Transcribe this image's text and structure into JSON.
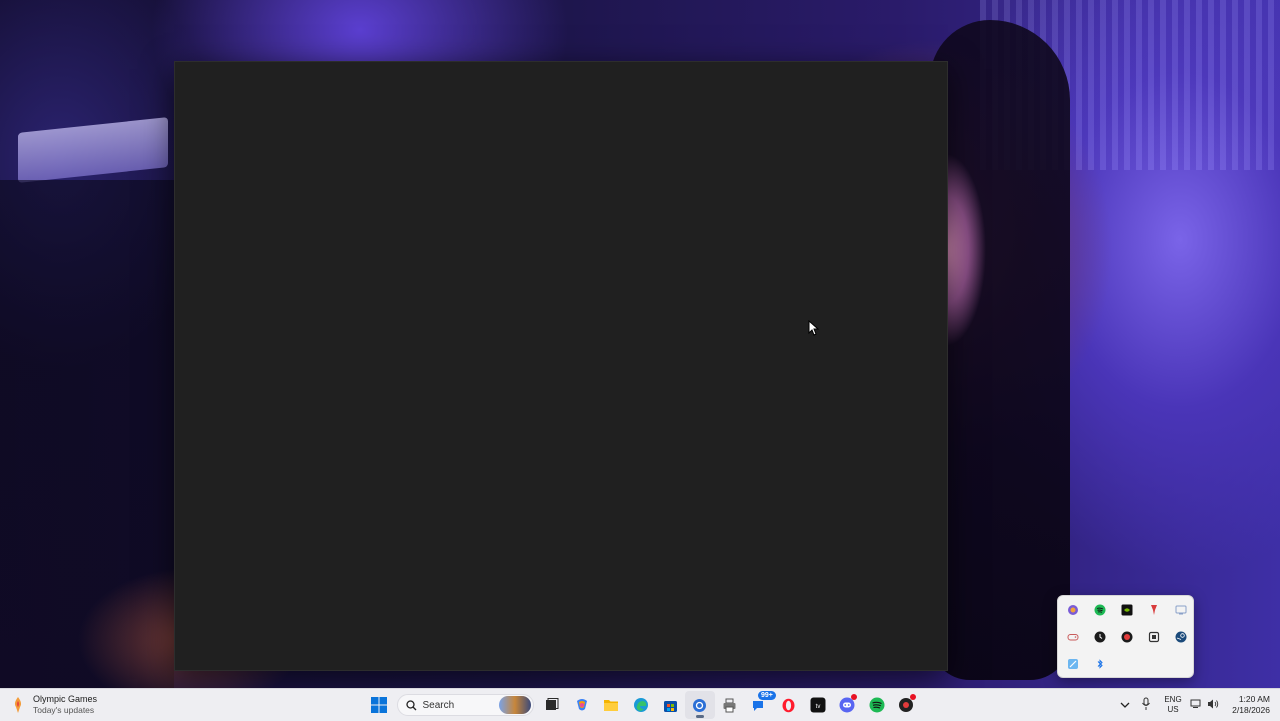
{
  "desktop": {
    "wallpaper": "dim purple-lit room photo"
  },
  "app_window": {
    "background": "#202020"
  },
  "taskbar": {
    "widget": {
      "title": "Olympic Games",
      "subtitle": "Today's updates",
      "icon": "torch-icon"
    },
    "search": {
      "placeholder": "Search"
    },
    "apps": [
      {
        "name": "start-button",
        "icon": "windows-logo-icon"
      },
      {
        "name": "task-view",
        "icon": "task-view-icon"
      },
      {
        "name": "copilot",
        "icon": "copilot-icon"
      },
      {
        "name": "file-explorer",
        "icon": "folder-icon"
      },
      {
        "name": "edge",
        "icon": "edge-icon"
      },
      {
        "name": "microsoft-store",
        "icon": "store-icon"
      },
      {
        "name": "active-app",
        "icon": "app-icon"
      },
      {
        "name": "printer",
        "icon": "printer-icon"
      },
      {
        "name": "teams-chat",
        "icon": "chat-icon",
        "badge": "99+"
      },
      {
        "name": "opera",
        "icon": "opera-icon"
      },
      {
        "name": "apple-tv",
        "icon": "apple-tv-icon"
      },
      {
        "name": "discord",
        "icon": "discord-icon",
        "badge": "3"
      },
      {
        "name": "spotify",
        "icon": "spotify-icon"
      },
      {
        "name": "unknown-app",
        "icon": "red-dot-app-icon"
      }
    ],
    "tray": {
      "language_primary": "ENG",
      "language_secondary": "US",
      "time": "1:20 AM",
      "date": "2/18/2026"
    }
  },
  "tray_flyout": {
    "icons": [
      "colorful-app-icon",
      "spotify-icon",
      "nvidia-icon",
      "red-pin-icon",
      "monitor-icon",
      "game-controller-icon",
      "clock-app-icon",
      "red-app-icon",
      "frame-icon",
      "steam-icon",
      "snip-icon",
      "bluetooth-icon"
    ]
  },
  "colors": {
    "taskbar_bg": "#eeeef2",
    "window_bg": "#202020",
    "accent": "#1a73e8"
  }
}
